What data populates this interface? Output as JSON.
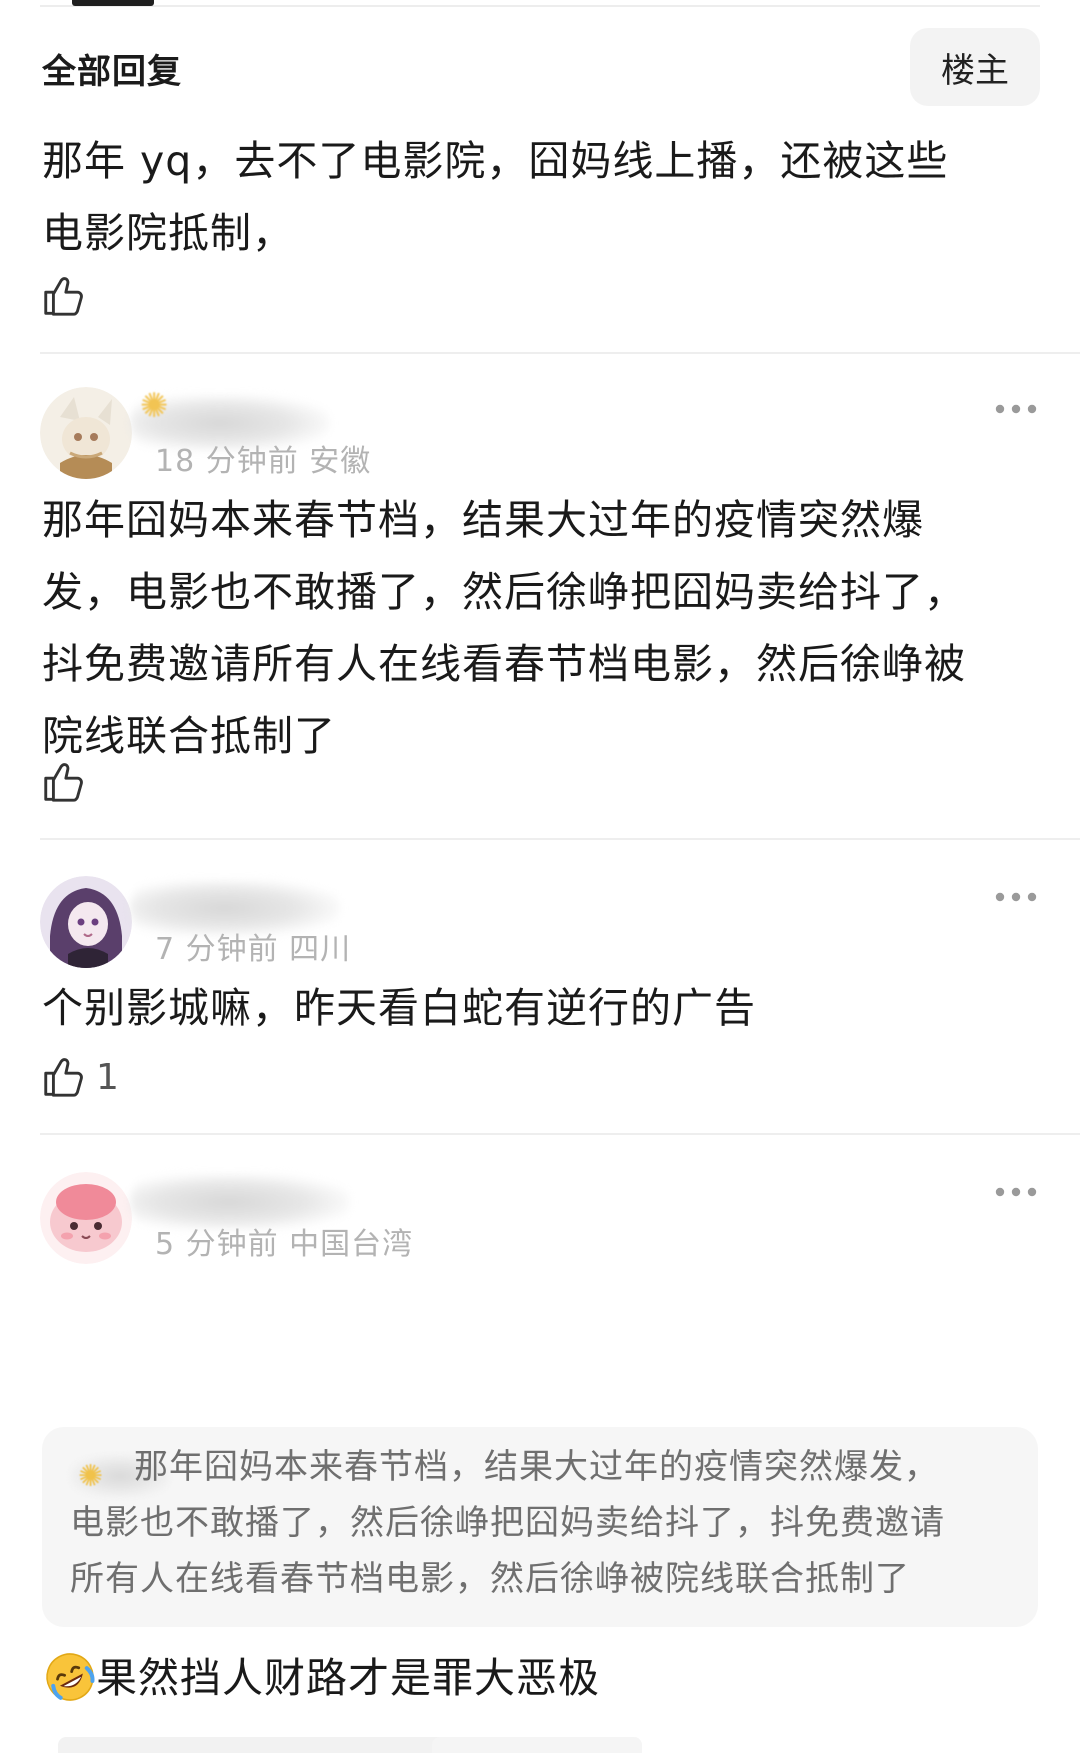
{
  "header": {
    "title": "全部回复",
    "author_toggle": "楼主"
  },
  "comments": [
    {
      "text_lines": [
        "那年 yq，去不了电影院，囧妈线上播，还被这些",
        "电影院抵制，"
      ],
      "like_count": ""
    },
    {
      "meta": "18 分钟前  安徽",
      "text_lines": [
        "那年囧妈本来春节档，结果大过年的疫情突然爆",
        "发，电影也不敢播了，然后徐峥把囧妈卖给抖了，",
        "抖免费邀请所有人在线看春节档电影，然后徐峥被",
        "院线联合抵制了"
      ],
      "like_count": ""
    },
    {
      "meta": "7 分钟前  四川",
      "text_lines": [
        "个别影城嘛，昨天看白蛇有逆行的广告"
      ],
      "like_count": "1"
    },
    {
      "meta": "5 分钟前  中国台湾",
      "quote_lines": [
        "那年囧妈本来春节档，结果大过年的疫情突然爆发，",
        "电影也不敢播了，然后徐峥把囧妈卖给抖了，抖免费邀请",
        "所有人在线看春节档电影，然后徐峥被院线联合抵制了"
      ],
      "reaction_emoji": "rolling-on-floor-laughing",
      "text": "果然挡人财路才是罪大恶极"
    }
  ],
  "colors": {
    "text": "#1a1a1a",
    "meta": "#b3b3b3",
    "quote_bg": "#f6f6f6",
    "divider": "#eeeeee",
    "toggle_bg": "#f3f3f3"
  },
  "icons": [
    "thumbs-up-icon",
    "more-dots-icon",
    "laughing-emoji-icon"
  ]
}
